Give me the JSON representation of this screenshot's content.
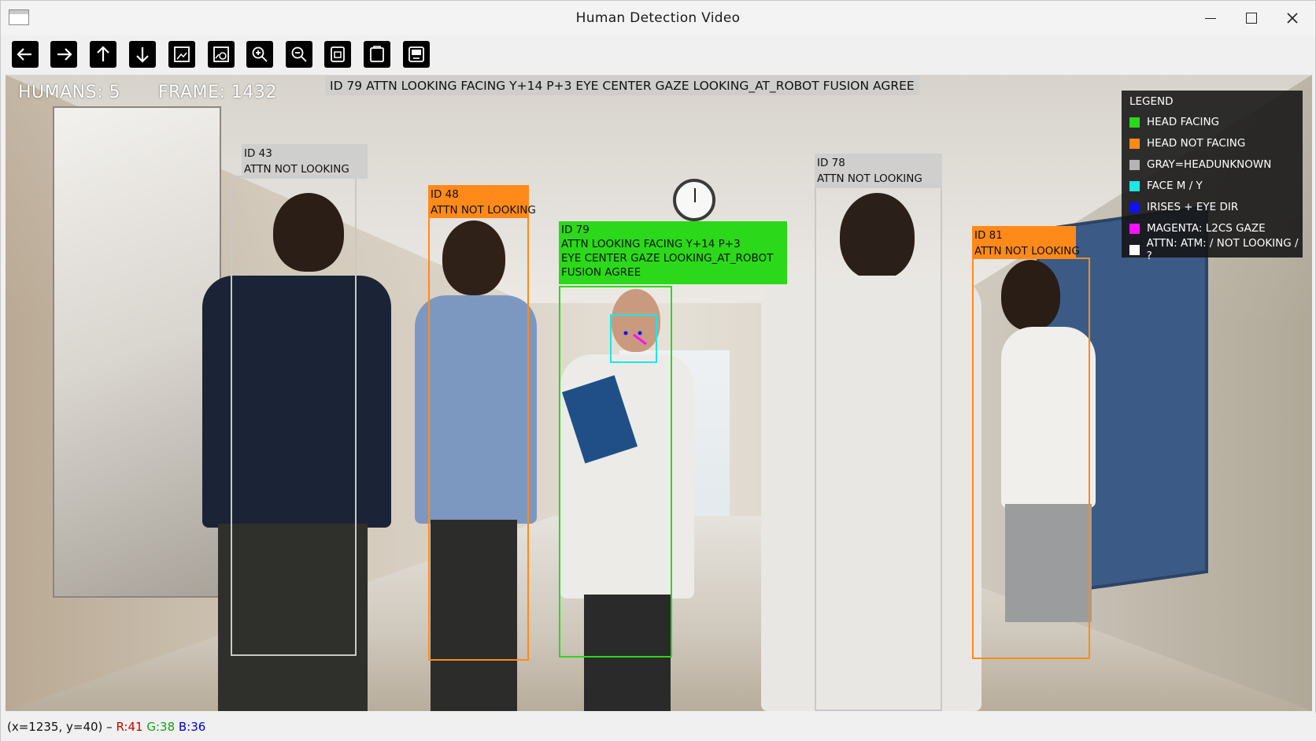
{
  "window": {
    "title": "Human Detection Video"
  },
  "toolbar": {
    "buttons": [
      {
        "name": "pan-left-button",
        "icon": "arrow-left-icon"
      },
      {
        "name": "pan-right-button",
        "icon": "arrow-right-icon"
      },
      {
        "name": "pan-up-button",
        "icon": "arrow-up-icon"
      },
      {
        "name": "pan-down-button",
        "icon": "arrow-down-icon"
      },
      {
        "name": "zoom-fit-button",
        "icon": "image-fit-icon"
      },
      {
        "name": "zoom-region-button",
        "icon": "image-region-icon"
      },
      {
        "name": "zoom-in-button",
        "icon": "zoom-in-icon"
      },
      {
        "name": "zoom-out-button",
        "icon": "zoom-out-icon"
      },
      {
        "name": "save-button",
        "icon": "save-icon"
      },
      {
        "name": "copy-clipboard-button",
        "icon": "clipboard-icon"
      },
      {
        "name": "properties-button",
        "icon": "properties-icon"
      }
    ]
  },
  "overlay": {
    "humans": "HUMANS: 5",
    "frame": "FRAME: 1432",
    "banner": "ID  79  ATTN  LOOKING  FACING  Y+14  P+3  EYE CENTER  GAZE  LOOKING_AT_ROBOT  FUSION  AGREE"
  },
  "legend": {
    "title": "LEGEND",
    "items": [
      {
        "label": "HEAD  FACING",
        "color": "#2bd91a"
      },
      {
        "label": "HEAD  NOT  FACING",
        "color": "#ff8a1a"
      },
      {
        "label": "GRAY=HEADUNKNOWN",
        "color": "#b4b4b4"
      },
      {
        "label": "FACE  M  /  Y",
        "color": "#1de6e6"
      },
      {
        "label": "IRISES  +  EYE  DIR",
        "color": "#1010ff"
      },
      {
        "label": "MAGENTA:  L2CS  GAZE",
        "color": "#ff10ff"
      },
      {
        "label": "ATTN: ATM:  /  NOT  LOOKING  /  ?",
        "color": "#ffffff"
      }
    ]
  },
  "detections": [
    {
      "id_text": "ID  43",
      "attn_text": "ATTN  NOT  LOOKING",
      "status": "unknown",
      "color": "#c8c8c8"
    },
    {
      "id_text": "ID  48",
      "attn_text": "ATTN  NOT  LOOKING",
      "status": "not-facing",
      "color": "#ff8a1a"
    },
    {
      "id_text": "ID  79",
      "line2": "ATTN  LOOKING  FACING  Y+14  P+3",
      "line3": "EYE  CENTER  GAZE  LOOKING_AT_ROBOT",
      "line4": "FUSION  AGREE",
      "status": "facing",
      "color": "#2bd91a"
    },
    {
      "id_text": "ID  78",
      "attn_text": "ATTN  NOT  LOOKING",
      "status": "unknown",
      "color": "#c8c8c8"
    },
    {
      "id_text": "ID  81",
      "attn_text": "ATTN  NOT  LOOKING",
      "status": "not-facing",
      "color": "#ff8a1a"
    }
  ],
  "status": {
    "coords": "(x=1235, y=40) –",
    "r": "R:41",
    "g": "G:38",
    "b": "B:36"
  }
}
